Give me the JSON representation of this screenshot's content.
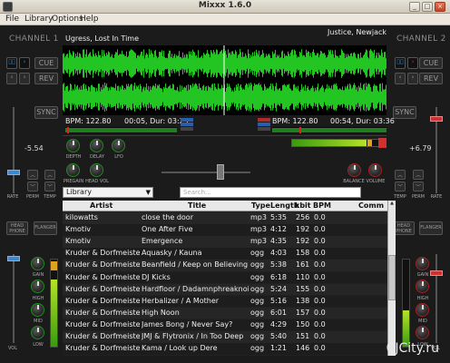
{
  "window": {
    "title": "Mixxx 1.6.0"
  },
  "menu": [
    "File",
    "Library",
    "Options",
    "Help"
  ],
  "channel1": {
    "label": "CHANNEL 1",
    "track": "Ugress, Lost In Time",
    "bpm": "BPM: 122.80",
    "time": "00:05, Dur: 03:29",
    "pitch": "-5.54",
    "cue": "CUE",
    "rev": "REV",
    "sync": "SYNC",
    "headphone": "HEAD PHONE",
    "flanger": "FLANGER",
    "knobs": [
      "DEPTH",
      "DELAY",
      "LFO",
      "PREGAIN",
      "HEAD VOL"
    ],
    "bottom": [
      "RATE",
      "PERM",
      "TEMP"
    ],
    "eq": [
      "GAIN",
      "HIGH",
      "MID",
      "LOW"
    ],
    "vol": "VOL"
  },
  "channel2": {
    "label": "CHANNEL 2",
    "track": "Justice, Newjack",
    "bpm": "BPM: 122.80",
    "time": "00:54, Dur: 03:36",
    "pitch": "+6.79",
    "cue": "CUE",
    "rev": "REV",
    "sync": "SYNC",
    "headphone": "HEAD PHONE",
    "flanger": "FLANGER",
    "knobs": [
      "BALANCE",
      "VOLUME"
    ],
    "bottom": [
      "TEMP",
      "PERM",
      "RATE"
    ],
    "eq": [
      "GAIN",
      "HIGH",
      "MID",
      "LOW"
    ],
    "vol": "VOL"
  },
  "library": {
    "source": "Library",
    "search_placeholder": "Search...",
    "columns": [
      "Artist",
      "Title",
      "Type",
      "Length",
      "kbit",
      "BPM",
      "Comm"
    ],
    "rows": [
      [
        "kilowatts",
        "close the door",
        "mp3",
        "5:35",
        "256",
        "0.0"
      ],
      [
        "Kmotiv",
        "One After Five",
        "mp3",
        "4:12",
        "192",
        "0.0"
      ],
      [
        "Kmotiv",
        "Emergence",
        "mp3",
        "4:35",
        "192",
        "0.0"
      ],
      [
        "Kruder & Dorfmeister",
        "Aquasky / Kauna",
        "ogg",
        "4:03",
        "158",
        "0.0"
      ],
      [
        "Kruder & Dorfmeister",
        "Beanfield / Keep on Believing",
        "ogg",
        "5:38",
        "161",
        "0.0"
      ],
      [
        "Kruder & Dorfmeister",
        "DJ Kicks",
        "ogg",
        "6:18",
        "110",
        "0.0"
      ],
      [
        "Kruder & Dorfmeister",
        "Hardfloor / Dadamnphreaknoizp...",
        "ogg",
        "5:24",
        "155",
        "0.0"
      ],
      [
        "Kruder & Dorfmeister",
        "Herbalizer / A Mother",
        "ogg",
        "5:16",
        "138",
        "0.0"
      ],
      [
        "Kruder & Dorfmeister",
        "High Noon",
        "ogg",
        "6:01",
        "157",
        "0.0"
      ],
      [
        "Kruder & Dorfmeister",
        "James Bong / Never Say?",
        "ogg",
        "4:29",
        "150",
        "0.0"
      ],
      [
        "Kruder & Dorfmeister",
        "JMJ & Flytronix / In Too Deep",
        "ogg",
        "5:40",
        "151",
        "0.0"
      ],
      [
        "Kruder & Dorfmeister",
        "Kama / Look up Dere",
        "ogg",
        "1:21",
        "146",
        "0.0"
      ]
    ]
  },
  "watermark": "CJCity.ru"
}
